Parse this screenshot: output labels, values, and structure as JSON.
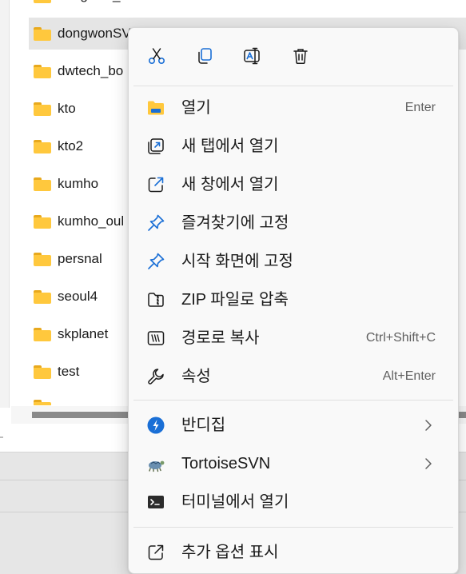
{
  "explorer": {
    "files": [
      {
        "name": "dongwon_bbots"
      },
      {
        "name": "dongwonSVN"
      },
      {
        "name": "dwtech_bo"
      },
      {
        "name": "kto"
      },
      {
        "name": "kto2"
      },
      {
        "name": "kumho"
      },
      {
        "name": "kumho_oul"
      },
      {
        "name": "persnal"
      },
      {
        "name": "seoul4"
      },
      {
        "name": "skplanet"
      },
      {
        "name": "test"
      },
      {
        "name": ""
      }
    ],
    "selected_file": "dongwonSVN"
  },
  "context_menu": {
    "quick_actions": [
      {
        "icon": "cut-icon",
        "label": "잘라내기"
      },
      {
        "icon": "copy-icon",
        "label": "복사"
      },
      {
        "icon": "rename-icon",
        "label": "이름 바꾸기"
      },
      {
        "icon": "delete-icon",
        "label": "삭제"
      }
    ],
    "items": [
      {
        "label": "열기",
        "shortcut": "Enter",
        "icon": "open-folder-icon"
      },
      {
        "label": "새 탭에서 열기",
        "shortcut": "",
        "icon": "new-tab-icon"
      },
      {
        "label": "새 창에서 열기",
        "shortcut": "",
        "icon": "new-window-icon"
      },
      {
        "label": "즐겨찾기에 고정",
        "shortcut": "",
        "icon": "pin-icon"
      },
      {
        "label": "시작 화면에 고정",
        "shortcut": "",
        "icon": "pin-start-icon"
      },
      {
        "label": "ZIP 파일로 압축",
        "shortcut": "",
        "icon": "zip-icon"
      },
      {
        "label": "경로로 복사",
        "shortcut": "Ctrl+Shift+C",
        "icon": "copy-path-icon"
      },
      {
        "label": "속성",
        "shortcut": "Alt+Enter",
        "icon": "wrench-icon"
      },
      {
        "label": "반디집",
        "shortcut": "",
        "icon": "bandizip-icon",
        "submenu": true
      },
      {
        "label": "TortoiseSVN",
        "shortcut": "",
        "icon": "tortoisesvn-icon",
        "submenu": true
      },
      {
        "label": "터미널에서 열기",
        "shortcut": "",
        "icon": "terminal-icon"
      },
      {
        "label": "추가 옵션 표시",
        "shortcut": "",
        "icon": "more-options-icon"
      }
    ]
  },
  "colors": {
    "folder": "#ffc83d",
    "folder_tab": "#e8a91d",
    "accent": "#1a6fd6",
    "menu_bg": "#f9f9f9",
    "selected_row": "#e5e5e5"
  }
}
